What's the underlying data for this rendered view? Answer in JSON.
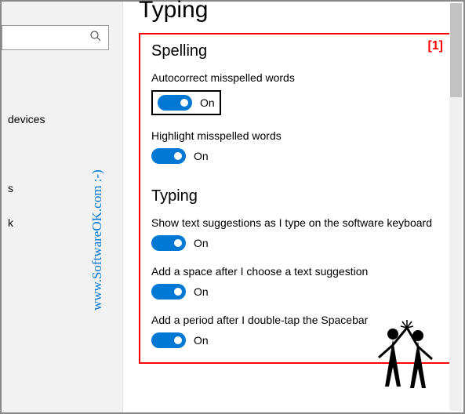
{
  "page": {
    "title": "Typing"
  },
  "sidebar": {
    "items": [
      {
        "label": "devices"
      },
      {
        "label": ""
      },
      {
        "label": "s"
      },
      {
        "label": "k"
      }
    ]
  },
  "marker": "[1]",
  "sections": {
    "spelling": {
      "heading": "Spelling",
      "autocorrect": {
        "label": "Autocorrect misspelled words",
        "state": "On"
      },
      "highlight": {
        "label": "Highlight misspelled words",
        "state": "On"
      }
    },
    "typing": {
      "heading": "Typing",
      "suggestions": {
        "label": "Show text suggestions as I type on the software keyboard",
        "state": "On"
      },
      "addspace": {
        "label": "Add a space after I choose a text suggestion",
        "state": "On"
      },
      "addperiod": {
        "label": "Add a period after I double-tap the Spacebar",
        "state": "On"
      }
    }
  },
  "watermark": "www.SoftwareOK.com :-)"
}
